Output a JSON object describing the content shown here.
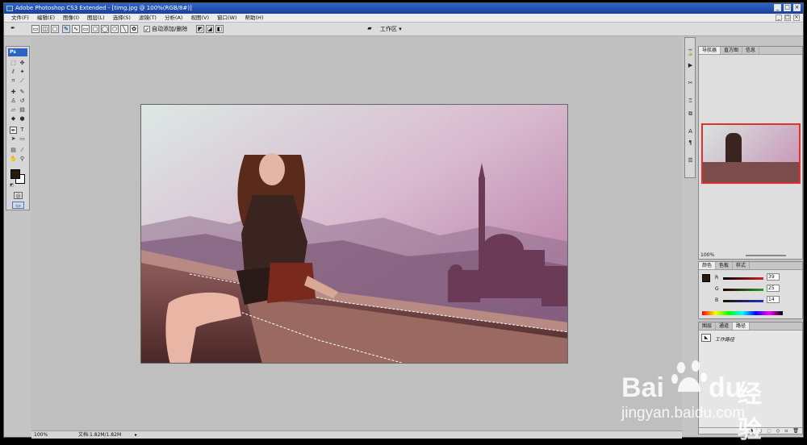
{
  "window": {
    "title": "Adobe Photoshop CS3 Extended - [timg.jpg @ 100%(RGB/8#)]",
    "controls": [
      "_",
      "□",
      "×"
    ]
  },
  "menubar": {
    "items": [
      "文件(F)",
      "编辑(E)",
      "图像(I)",
      "图层(L)",
      "选择(S)",
      "滤镜(T)",
      "分析(A)",
      "视图(V)",
      "窗口(W)",
      "帮助(H)"
    ],
    "doc_controls": [
      "_",
      "□",
      "×"
    ]
  },
  "options_bar": {
    "auto_add_delete": "自动添加/删除",
    "workspace": "工作区 ▾"
  },
  "toolbox": {
    "logo": "Ps"
  },
  "status_bar": {
    "zoom": "100%",
    "doc_info": "文档:1.82M/1.82M"
  },
  "navigator_panel": {
    "tabs": [
      "导航器",
      "直方图",
      "信息"
    ],
    "zoom": "100%"
  },
  "color_panel": {
    "tabs": [
      "颜色",
      "色板",
      "样式"
    ],
    "r_label": "R",
    "r_value": "39",
    "g_label": "G",
    "g_value": "25",
    "b_label": "B",
    "b_value": "14"
  },
  "layers_panel": {
    "tabs": [
      "图层",
      "通道",
      "路径"
    ],
    "work_path": "工作路径"
  },
  "watermark": {
    "brand": "Bai",
    "brand_tail": "du",
    "chinese": "经验",
    "url": "jingyan.baidu.com"
  }
}
